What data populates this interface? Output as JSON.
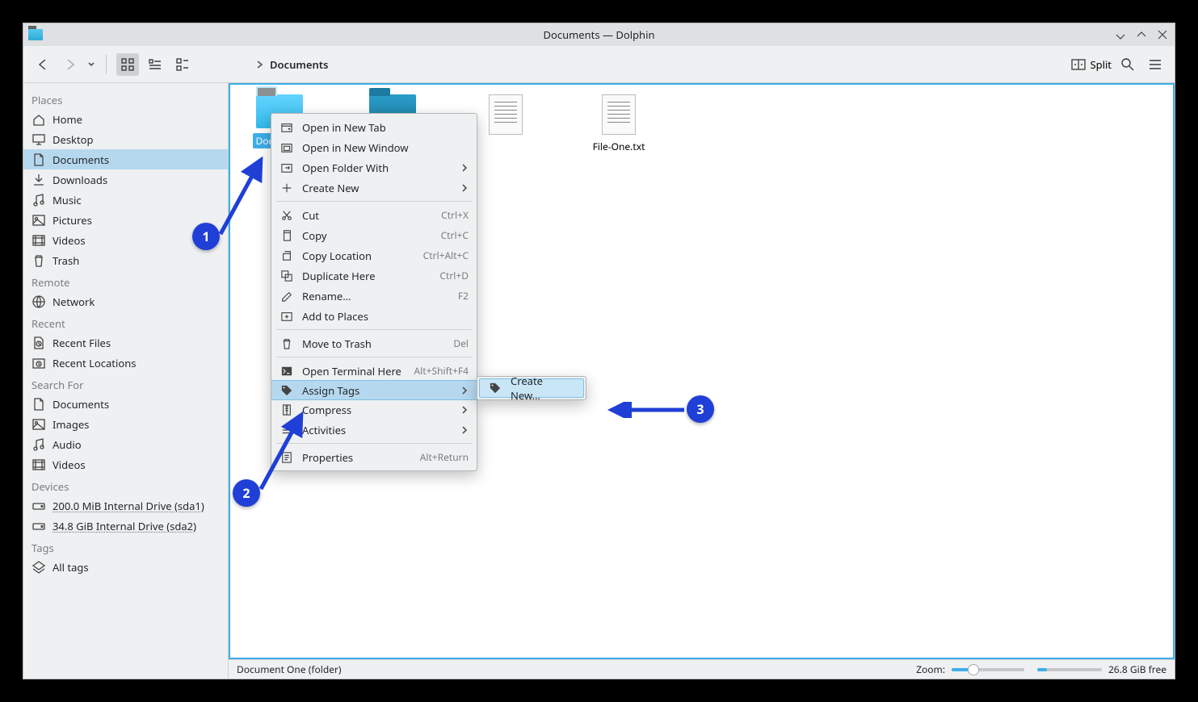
{
  "window": {
    "title": "Documents — Dolphin"
  },
  "toolbar": {
    "breadcrumb": "Documents",
    "split_label": "Split"
  },
  "sidebar": {
    "sections": [
      {
        "header": "Places",
        "items": [
          {
            "icon": "home",
            "label": "Home"
          },
          {
            "icon": "desktop",
            "label": "Desktop"
          },
          {
            "icon": "doc",
            "label": "Documents",
            "selected": true
          },
          {
            "icon": "download",
            "label": "Downloads"
          },
          {
            "icon": "music",
            "label": "Music"
          },
          {
            "icon": "pictures",
            "label": "Pictures"
          },
          {
            "icon": "video",
            "label": "Videos"
          },
          {
            "icon": "trash",
            "label": "Trash"
          }
        ]
      },
      {
        "header": "Remote",
        "items": [
          {
            "icon": "network",
            "label": "Network"
          }
        ]
      },
      {
        "header": "Recent",
        "items": [
          {
            "icon": "recentfiles",
            "label": "Recent Files"
          },
          {
            "icon": "recentloc",
            "label": "Recent Locations"
          }
        ]
      },
      {
        "header": "Search For",
        "items": [
          {
            "icon": "doc",
            "label": "Documents"
          },
          {
            "icon": "pictures",
            "label": "Images"
          },
          {
            "icon": "music",
            "label": "Audio"
          },
          {
            "icon": "video",
            "label": "Videos"
          }
        ]
      },
      {
        "header": "Devices",
        "items": [
          {
            "icon": "drive",
            "label": "200.0 MiB Internal Drive (sda1)",
            "underline": true
          },
          {
            "icon": "drive",
            "label": "34.8 GiB Internal Drive (sda2)",
            "underline": true
          }
        ]
      },
      {
        "header": "Tags",
        "items": [
          {
            "icon": "tags",
            "label": "All tags"
          }
        ]
      }
    ]
  },
  "files": [
    {
      "type": "folder",
      "label": "Document One",
      "selected": true
    },
    {
      "type": "folder-dark",
      "label": ""
    },
    {
      "type": "file",
      "label": ""
    },
    {
      "type": "file",
      "label": "File-One.txt"
    }
  ],
  "contextMenu": [
    {
      "icon": "newtab",
      "label": "Open in New Tab"
    },
    {
      "icon": "newwin",
      "label": "Open in New Window"
    },
    {
      "icon": "openwith",
      "label": "Open Folder With",
      "submenu": true
    },
    {
      "icon": "plus",
      "label": "Create New",
      "submenu": true
    },
    {
      "sep": true
    },
    {
      "icon": "cut",
      "label": "Cut",
      "shortcut": "Ctrl+X"
    },
    {
      "icon": "copy",
      "label": "Copy",
      "shortcut": "Ctrl+C"
    },
    {
      "icon": "copyloc",
      "label": "Copy Location",
      "shortcut": "Ctrl+Alt+C"
    },
    {
      "icon": "dup",
      "label": "Duplicate Here",
      "shortcut": "Ctrl+D"
    },
    {
      "icon": "rename",
      "label": "Rename…",
      "shortcut": "F2"
    },
    {
      "icon": "addplaces",
      "label": "Add to Places"
    },
    {
      "sep": true
    },
    {
      "icon": "trash",
      "label": "Move to Trash",
      "shortcut": "Del"
    },
    {
      "sep": true
    },
    {
      "icon": "terminal",
      "label": "Open Terminal Here",
      "shortcut": "Alt+Shift+F4"
    },
    {
      "icon": "tag",
      "label": "Assign Tags",
      "submenu": true,
      "highlight": true
    },
    {
      "icon": "compress",
      "label": "Compress",
      "submenu": true
    },
    {
      "icon": "activities",
      "label": "Activities",
      "submenu": true
    },
    {
      "sep": true
    },
    {
      "icon": "props",
      "label": "Properties",
      "shortcut": "Alt+Return"
    }
  ],
  "submenu": [
    {
      "icon": "tag",
      "label": "Create New…",
      "highlight": true
    }
  ],
  "annotations": [
    "1",
    "2",
    "3"
  ],
  "statusbar": {
    "info": "Document One (folder)",
    "zoom_label": "Zoom:",
    "disk_free": "26.8 GiB free"
  }
}
